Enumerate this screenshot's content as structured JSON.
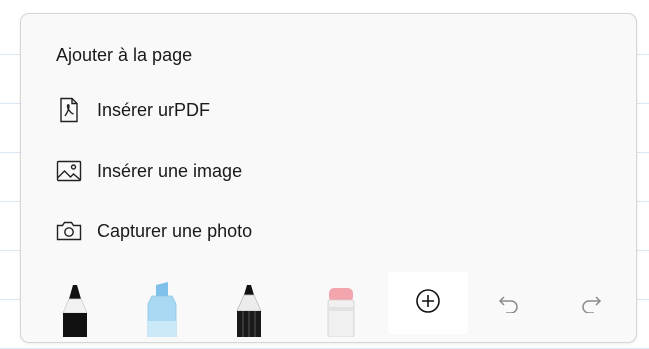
{
  "panel": {
    "title": "Ajouter à la page",
    "items": [
      {
        "label": "Insérer urPDF",
        "icon": "pdf-icon"
      },
      {
        "label": "Insérer une image",
        "icon": "image-icon"
      },
      {
        "label": "Capturer une photo",
        "icon": "camera-icon"
      }
    ]
  },
  "toolbar": {
    "tools": [
      "pen-tool-icon",
      "highlighter-tool-icon",
      "pencil-tool-icon",
      "eraser-tool-icon"
    ],
    "add_icon": "add-circle-icon",
    "undo_icon": "undo-icon",
    "redo_icon": "redo-icon"
  },
  "colors": {
    "panel_bg": "#f9f9f9",
    "highlighter": "#a9d8f2",
    "eraser_tip": "#f3a5ae"
  }
}
